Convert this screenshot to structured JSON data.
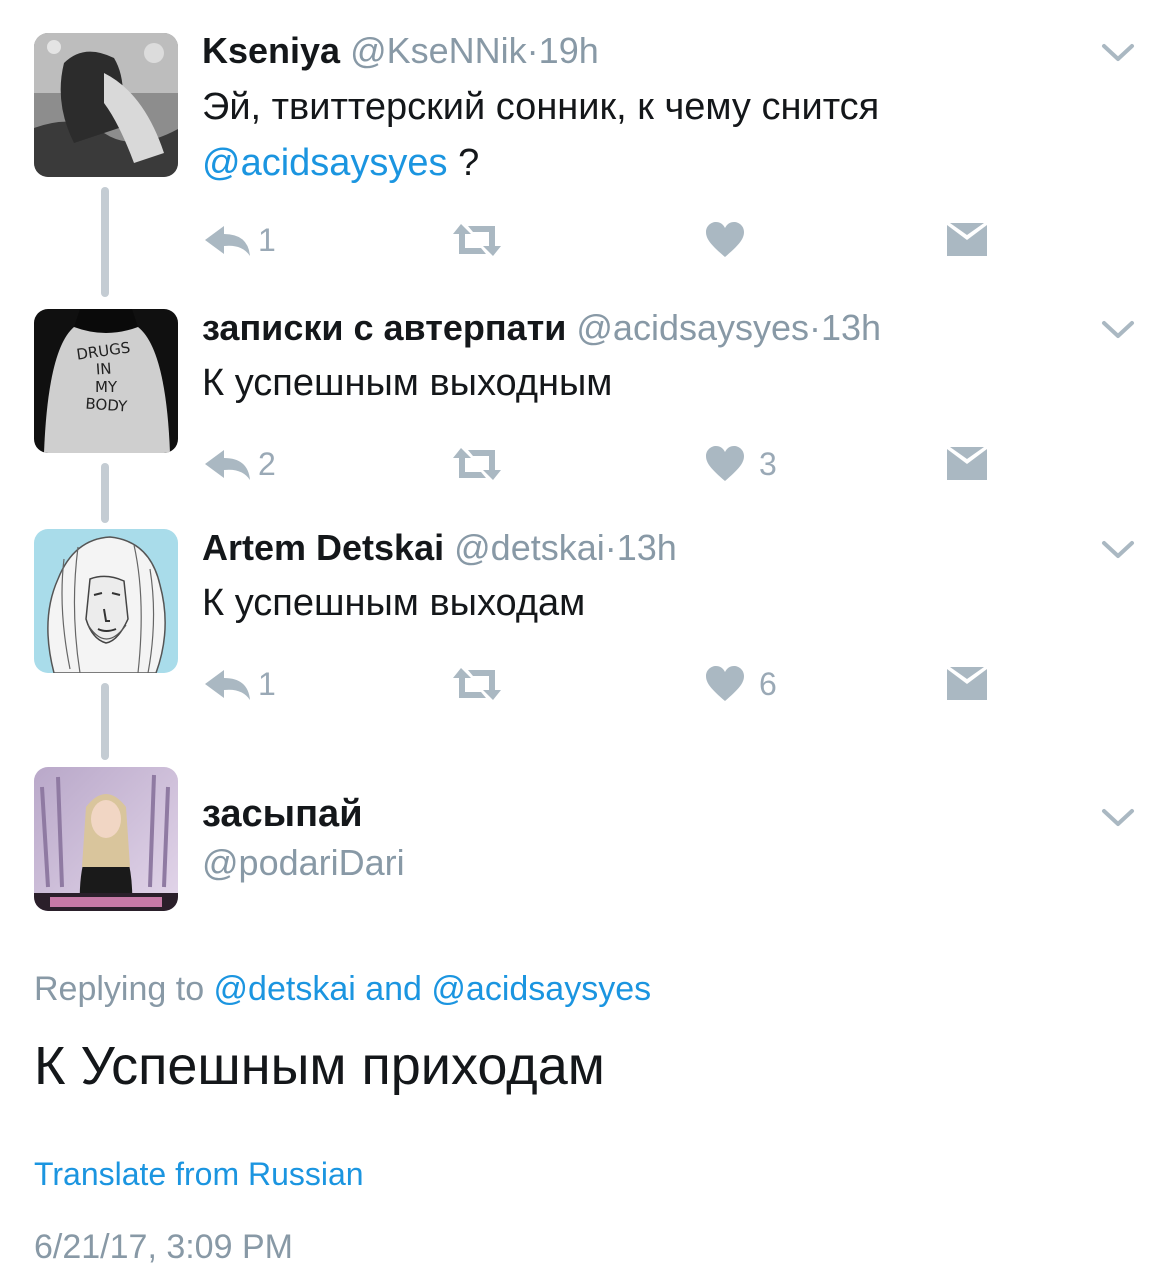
{
  "tweets": [
    {
      "name": "Kseniya",
      "handle": "@KseNNik",
      "dot": "·",
      "time": "19h",
      "text_line1": "Эй, твиттерский сонник, к чему снится",
      "mention": "@acidsaysyes",
      "text_after_mention": " ?",
      "reply_count": "1",
      "retweet_count": "",
      "like_count": ""
    },
    {
      "name": "записки с автерпати",
      "handle": "@acidsaysyes",
      "dot": "·",
      "time": "13h",
      "text": "К успешным выходным",
      "reply_count": "2",
      "retweet_count": "",
      "like_count": "3",
      "shirt_text": [
        "DRUGS",
        "IN",
        "MY",
        "BODY"
      ]
    },
    {
      "name": "Artem Detskai",
      "handle": "@detskai",
      "dot": "·",
      "time": "13h",
      "text": "К успешным выходам",
      "reply_count": "1",
      "retweet_count": "",
      "like_count": "6"
    }
  ],
  "focused": {
    "name": "засыпай",
    "handle": "@podariDari",
    "replying_prefix": "Replying to ",
    "replying_mention1": "@detskai",
    "replying_and": " and ",
    "replying_mention2": "@acidsaysyes",
    "text": "К Успешным приходам",
    "translate": "Translate from Russian",
    "timestamp": "6/21/17, 3:09 PM"
  },
  "icons": {
    "reply": "reply-icon",
    "retweet": "retweet-icon",
    "like": "heart-icon",
    "dm": "direct-message-icon",
    "more": "chevron-down-icon"
  },
  "colors": {
    "link": "#1b95e0",
    "secondary": "#8899a6",
    "icon": "#aab8c2",
    "thread_line": "#c4ccd3"
  }
}
